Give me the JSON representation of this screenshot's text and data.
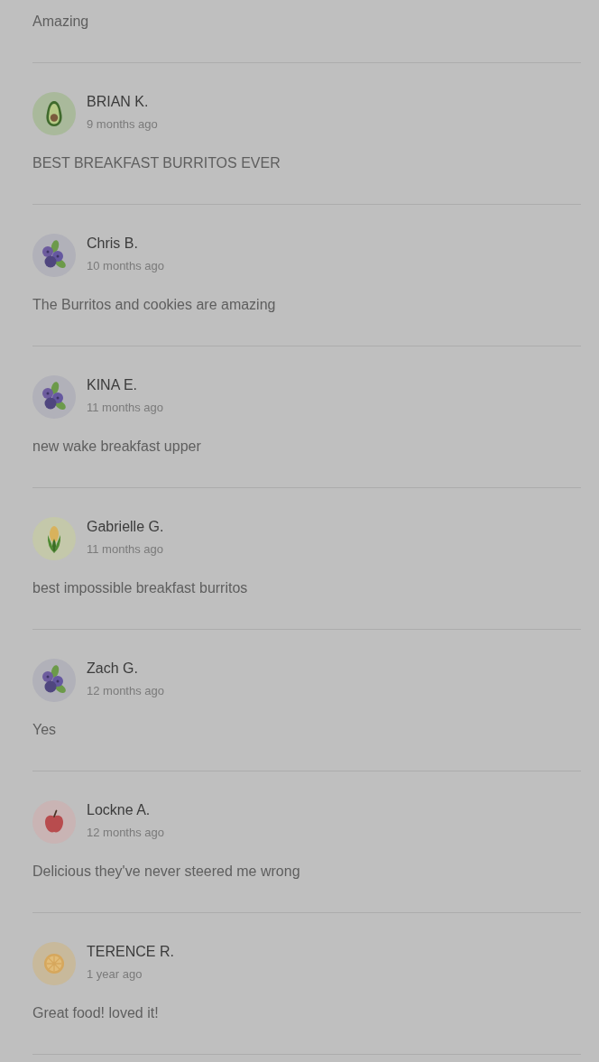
{
  "partial_review": {
    "text": "Amazing"
  },
  "reviews": [
    {
      "avatar": {
        "kind": "avocado"
      },
      "name": "BRIAN K.",
      "time": "9 months ago",
      "text": "BEST BREAKFAST BURRITOS EVER"
    },
    {
      "avatar": {
        "kind": "blueberries"
      },
      "name": "Chris B.",
      "time": "10 months ago",
      "text": "The Burritos and cookies are amazing"
    },
    {
      "avatar": {
        "kind": "blueberries"
      },
      "name": "KINA E.",
      "time": "11 months ago",
      "text": "new wake breakfast upper"
    },
    {
      "avatar": {
        "kind": "corn"
      },
      "name": "Gabrielle G.",
      "time": "11 months ago",
      "text": "best impossible breakfast burritos"
    },
    {
      "avatar": {
        "kind": "blueberries"
      },
      "name": "Zach G.",
      "time": "12 months ago",
      "text": "Yes"
    },
    {
      "avatar": {
        "kind": "apple"
      },
      "name": "Lockne A.",
      "time": "12 months ago",
      "text": "Delicious they've never steered me wrong"
    },
    {
      "avatar": {
        "kind": "citrus"
      },
      "name": "TERENCE R.",
      "time": "1 year ago",
      "text": "Great food! loved it!"
    }
  ]
}
